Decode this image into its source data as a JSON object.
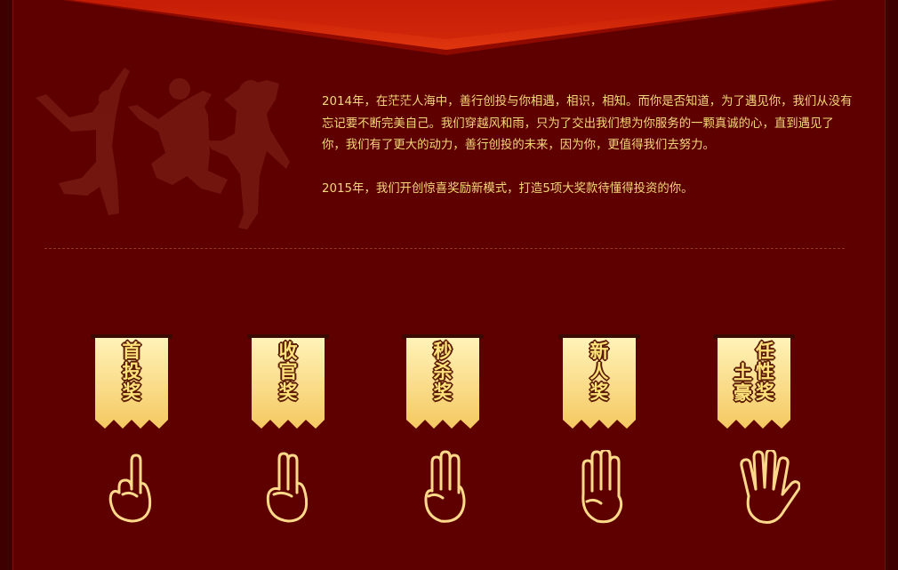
{
  "intro": {
    "paragraph1": "2014年，在茫茫人海中，善行创投与你相遇，相识，相知。而你是否知道，为了遇见你，我们从没有忘记要不断完美自己。我们穿越风和雨，只为了交出我们想为你服务的一颗真诚的心，直到遇见了你，我们有了更大的动力，善行创投的未来，因为你，更值得我们去努力。",
    "paragraph2": "2015年，我们开创惊喜奖励新模式，打造5项大奖款待懂得投资的你。"
  },
  "awards": [
    {
      "columns": [
        [
          "首",
          "投",
          "奖"
        ]
      ],
      "fingers": 1
    },
    {
      "columns": [
        [
          "收",
          "官",
          "奖"
        ]
      ],
      "fingers": 2
    },
    {
      "columns": [
        [
          "秒",
          "杀",
          "奖"
        ]
      ],
      "fingers": 3
    },
    {
      "columns": [
        [
          "新",
          "人",
          "奖"
        ]
      ],
      "fingers": 4
    },
    {
      "columns": [
        [
          "土",
          "豪"
        ],
        [
          "任",
          "性",
          "奖"
        ]
      ],
      "fingers": 5
    }
  ],
  "colors": {
    "background": "#5e0000",
    "text_gold": "#f3d77a",
    "banner_red": "#d6290a",
    "flag_top": "#fff3b8",
    "flag_bottom": "#f5c861",
    "hand_outline": "#ffd98a"
  },
  "icons": {
    "silhouette": "jumping-people-silhouette",
    "hand": "hand-counting-icon"
  }
}
